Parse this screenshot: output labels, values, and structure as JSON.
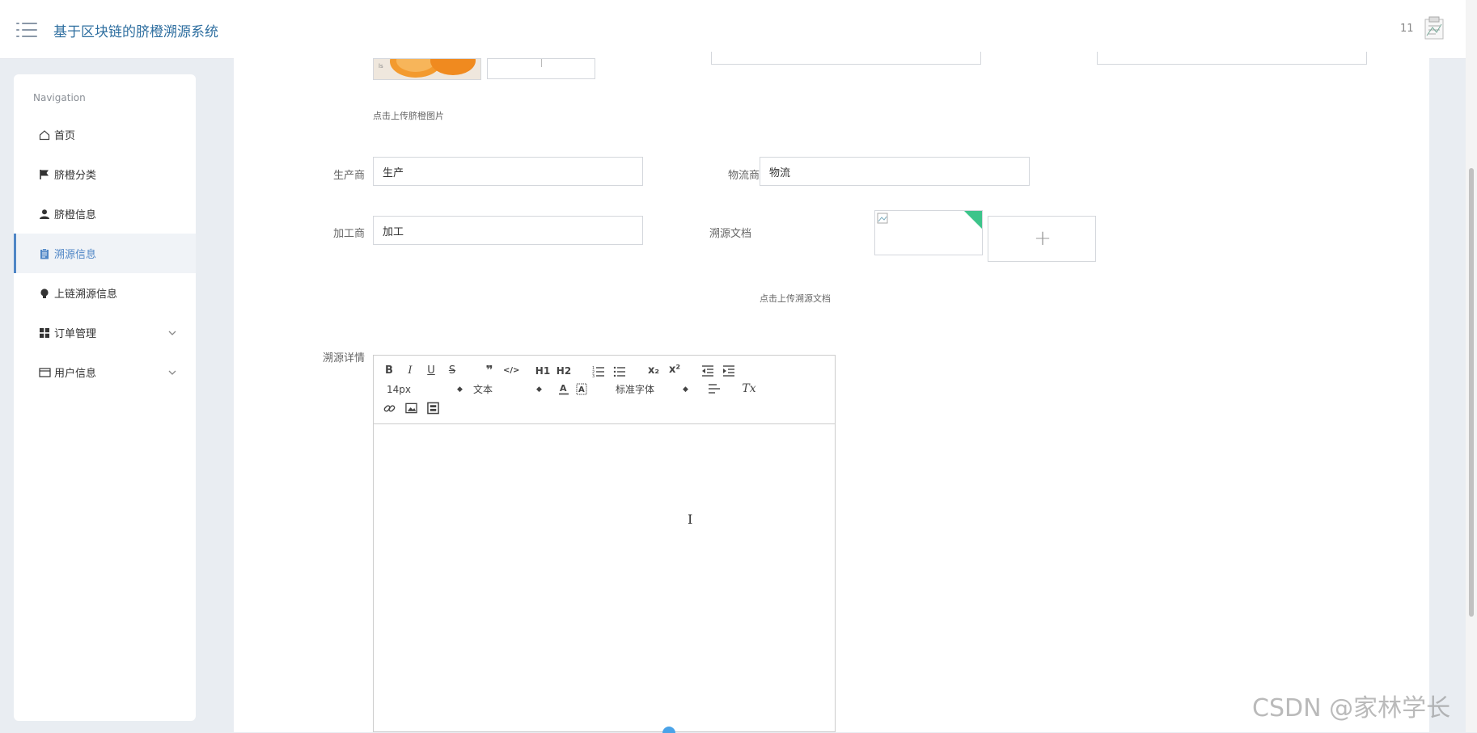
{
  "header": {
    "title": "基于区块链的脐橙溯源系统",
    "user_count": "11"
  },
  "sidebar": {
    "section_title": "Navigation",
    "items": [
      {
        "label": "首页",
        "icon": "home-icon"
      },
      {
        "label": "脐橙分类",
        "icon": "flag-icon"
      },
      {
        "label": "脐橙信息",
        "icon": "user-icon"
      },
      {
        "label": "溯源信息",
        "icon": "clipboard-icon",
        "active": true
      },
      {
        "label": "上链溯源信息",
        "icon": "bulb-icon"
      },
      {
        "label": "订单管理",
        "icon": "grid-icon",
        "expandable": true
      },
      {
        "label": "用户信息",
        "icon": "card-icon",
        "expandable": true
      }
    ]
  },
  "form": {
    "image_upload_hint": "点击上传脐橙图片",
    "producer_label": "生产商",
    "producer_value": "生产",
    "logistics_label": "物流商",
    "logistics_value": "物流",
    "processor_label": "加工商",
    "processor_value": "加工",
    "trace_doc_label": "溯源文档",
    "trace_doc_hint": "点击上传溯源文档",
    "detail_label": "溯源详情",
    "add_symbol": "+"
  },
  "editor": {
    "font_size": "14px",
    "heading_select": "文本",
    "font_family_select": "标准字体",
    "buttons": {
      "bold": "B",
      "italic": "I",
      "underline": "U",
      "strike": "S",
      "blockquote": "❞",
      "code": "</>",
      "h1": "H1",
      "h2": "H2",
      "subscript": "x₂",
      "superscript": "x²",
      "clean": "Tx"
    }
  },
  "watermark": "CSDN @家林学长",
  "colors": {
    "accent": "#4f86c6",
    "title": "#2f6fa0",
    "page_bg": "#e9edf2",
    "thumb_corner": "#3cc48a"
  }
}
